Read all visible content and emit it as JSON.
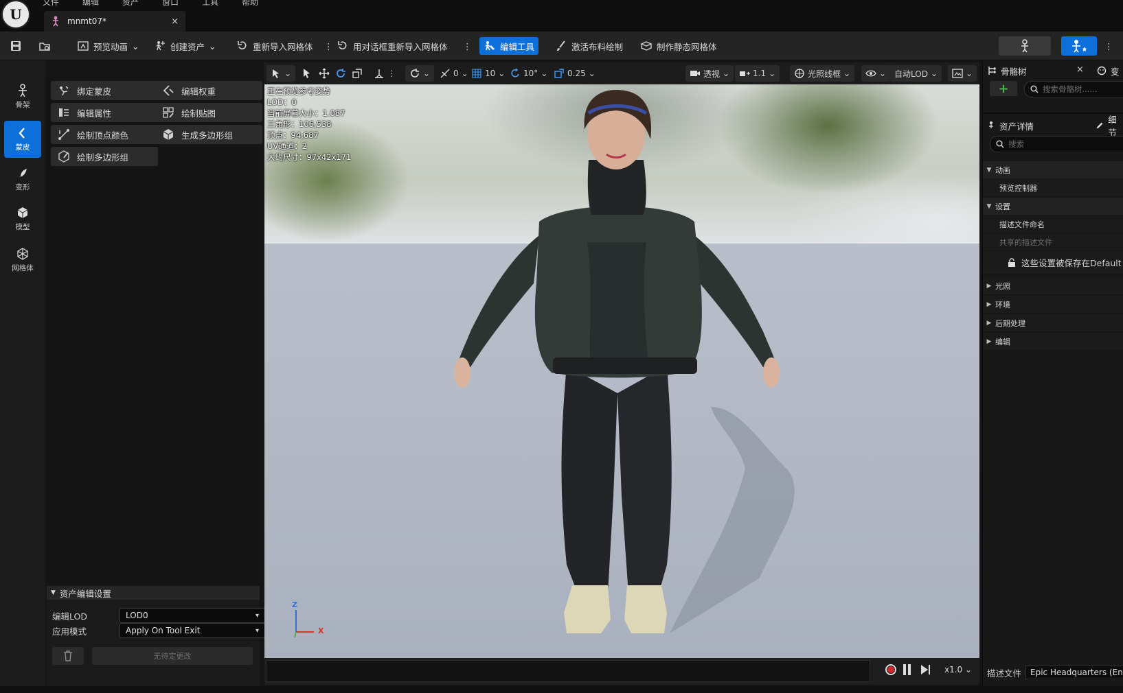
{
  "menu": [
    "文件",
    "编辑",
    "资产",
    "窗口",
    "工具",
    "帮助"
  ],
  "tab": {
    "title": "mnmt07*",
    "close": "×"
  },
  "toolbar": {
    "preview_anim": "预览动画",
    "create_asset": "创建资产",
    "reimport_mesh": "重新导入网格体",
    "reimport_dialog": "用对话框重新导入网格体",
    "edit_tools": "编辑工具",
    "cloth_paint": "激活布料绘制",
    "make_static": "制作静态网格体"
  },
  "modes": [
    {
      "label": "骨架",
      "icon": "skeleton-icon"
    },
    {
      "label": "蒙皮",
      "icon": "skin-icon"
    },
    {
      "label": "变形",
      "icon": "deform-icon"
    },
    {
      "label": "模型",
      "icon": "model-icon"
    },
    {
      "label": "网格体",
      "icon": "mesh-icon"
    }
  ],
  "tools": [
    {
      "label": "绑定蒙皮",
      "icon": "bind-skin-icon"
    },
    {
      "label": "编辑权重",
      "icon": "edit-weights-icon"
    },
    {
      "label": "编辑属性",
      "icon": "edit-attributes-icon"
    },
    {
      "label": "绘制贴图",
      "icon": "paint-maps-icon"
    },
    {
      "label": "绘制顶点颜色",
      "icon": "paint-vertex-color-icon"
    },
    {
      "label": "生成多边形组",
      "icon": "generate-polygroups-icon"
    },
    {
      "label": "绘制多边形组",
      "icon": "paint-polygroups-icon"
    }
  ],
  "asset_settings": {
    "header": "资产编辑设置",
    "lod_label": "编辑LOD",
    "lod_value": "LOD0",
    "apply_label": "应用模式",
    "apply_value": "Apply On Tool Exit",
    "no_changes": "无待定更改"
  },
  "viewport_toolbar": {
    "rot_snap_a": "0",
    "grid_snap": "10",
    "rot_snap": "10°",
    "scale_snap": "0.25",
    "perspective": "透视",
    "fov": "1.1",
    "view_mode": "光照线框",
    "lod": "自动LOD"
  },
  "viewport_info": [
    "正在预览参考姿势",
    "LOD：0",
    "当前屏幕大小：1.087",
    "三角形：106,538",
    "顶点：94,687",
    "UV通道：2",
    "大约尺寸：97x42x171"
  ],
  "axis": {
    "z": "Z",
    "x": "X"
  },
  "playback": {
    "speed": "x1.0"
  },
  "skeleton_tree": {
    "title": "骨骼树",
    "close": "×",
    "search_placeholder": "搜索骨骼树......",
    "other_tab": "变"
  },
  "details": {
    "title": "资产详情",
    "other_tab": "细节",
    "search_placeholder": "搜索",
    "sections": [
      {
        "name": "动画",
        "expanded": true,
        "props": [
          "预览控制器"
        ]
      },
      {
        "name": "设置",
        "expanded": true,
        "props": [
          "描述文件命名",
          "共享的描述文件"
        ],
        "note": "这些设置被保存在Default"
      },
      {
        "name": "光照",
        "expanded": false
      },
      {
        "name": "环境",
        "expanded": false
      },
      {
        "name": "后期处理",
        "expanded": false
      },
      {
        "name": "编辑",
        "expanded": false
      }
    ],
    "profile_label": "描述文件",
    "profile_value": "Epic Headquarters (Engi"
  },
  "colors": {
    "accent": "#0d6fd9",
    "record": "#d42a2a"
  }
}
